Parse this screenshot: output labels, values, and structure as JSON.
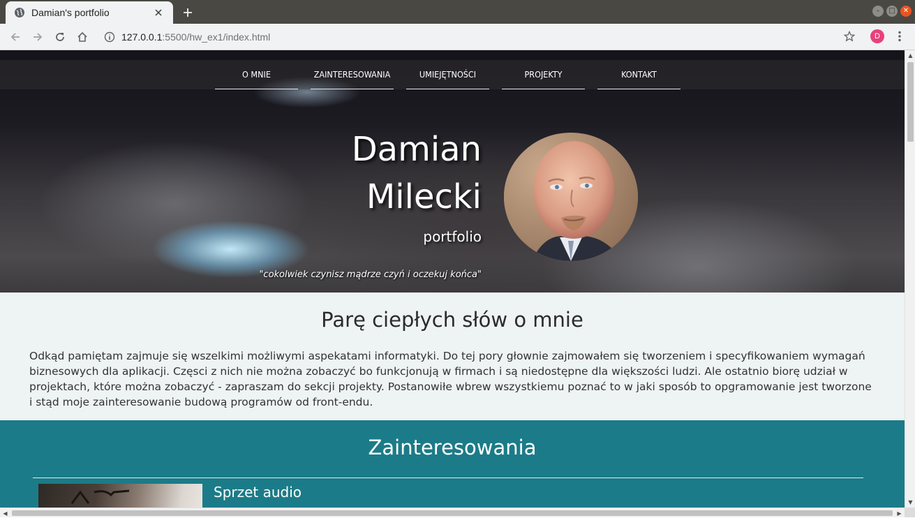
{
  "browser": {
    "tab_title": "Damian's portfolio",
    "url_host": "127.0.0.1",
    "url_path": ":5500/hw_ex1/index.html",
    "profile_initial": "D",
    "accent_color": "#e8407a",
    "close_button_color": "#e9541f",
    "icons": [
      "globe-icon",
      "close-icon",
      "plus-icon",
      "back-icon",
      "forward-icon",
      "reload-icon",
      "home-icon",
      "info-icon",
      "star-icon",
      "kebab-menu-icon"
    ]
  },
  "nav": {
    "items": [
      {
        "label": "O MNIE"
      },
      {
        "label": "ZAINTERESOWANIA"
      },
      {
        "label": "UMIEJĘTNOŚCI"
      },
      {
        "label": "PROJEKTY"
      },
      {
        "label": "KONTAKT"
      }
    ]
  },
  "hero": {
    "first_name": "Damian",
    "last_name": "Milecki",
    "subtitle": "portfolio",
    "quote": "\"cokolwiek czynisz mądrze czyń i oczekuj końca\""
  },
  "about": {
    "heading": "Parę ciepłych słów o mnie",
    "text": "Odkąd pamiętam zajmuje się wszelkimi możliwymi aspekatami informatyki. Do tej pory głownie zajmowałem się tworzeniem i specyfikowaniem wymagań biznesowych dla aplikacji. Częsci z nich nie można zobaczyć bo funkcjonują w firmach i są niedostępne dla większości ludzi. Ale ostatnio biorę udział w projektach, które można zobaczyć - zapraszam do sekcji projekty. Postanowiłe wbrew wszystkiemu poznać to w jaki sposób to opgramowanie jest tworzone i stąd moje zainteresowanie budową programów od front-endu."
  },
  "interests": {
    "heading": "Zainteresowania",
    "section_color": "#1c7b88",
    "items": [
      {
        "title": "Sprzet audio"
      }
    ]
  }
}
